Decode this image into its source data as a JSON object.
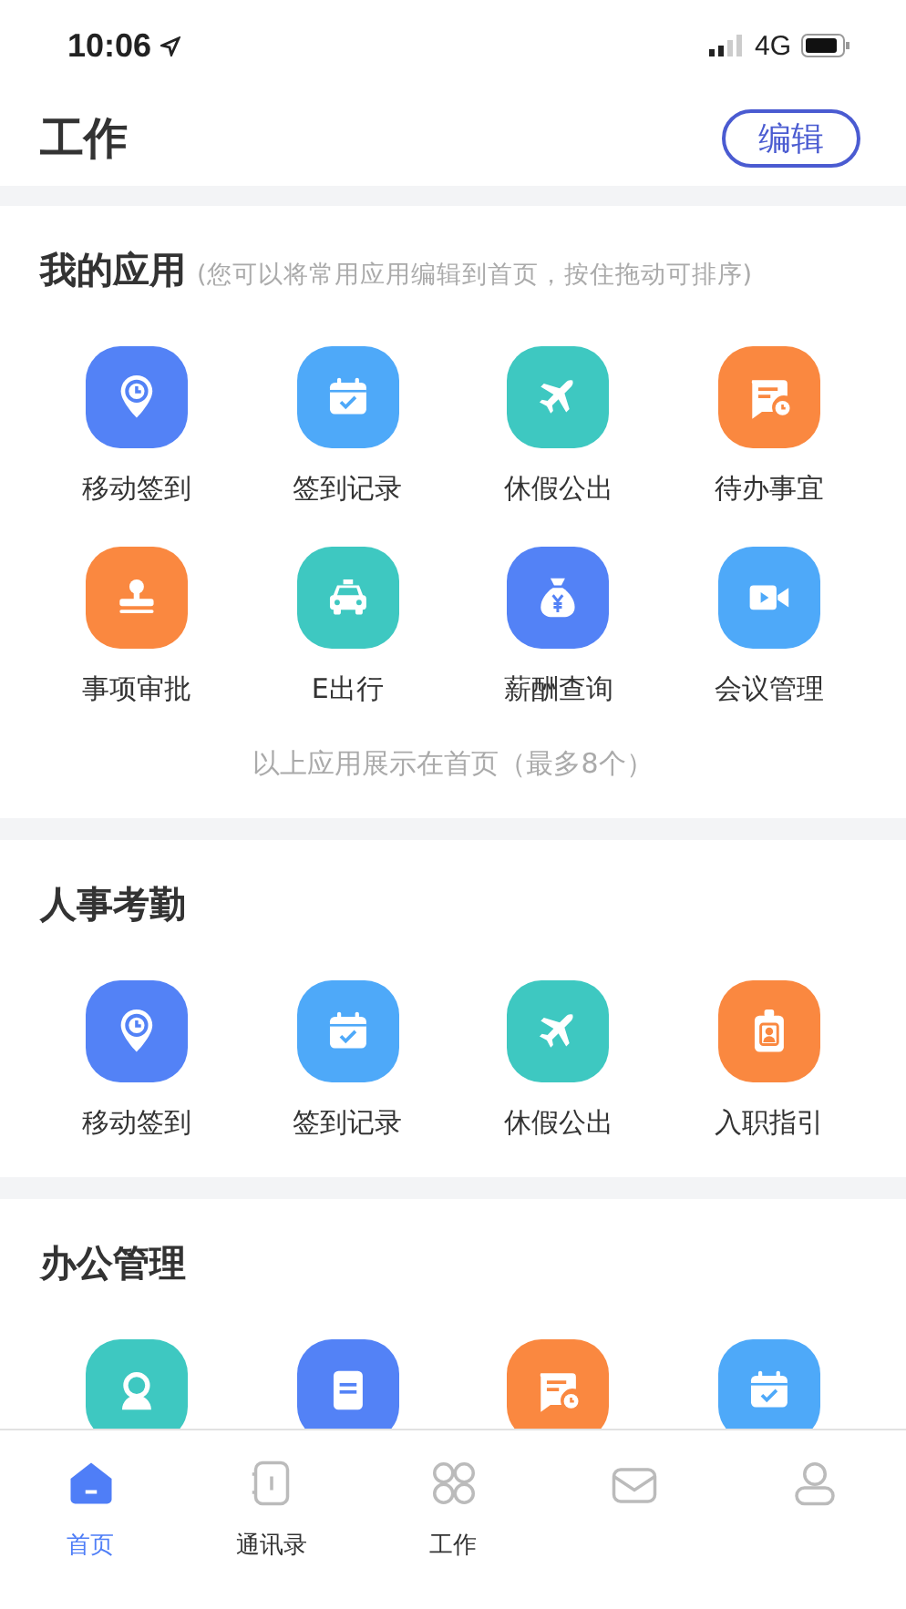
{
  "status_bar": {
    "time": "10:06",
    "network": "4G"
  },
  "header": {
    "title": "工作",
    "edit_button": "编辑"
  },
  "sections": [
    {
      "title": "我的应用",
      "hint": "(您可以将常用应用编辑到首页，按住拖动可排序)",
      "apps": [
        {
          "label": "移动签到",
          "kind": "location",
          "color": "#5382f6"
        },
        {
          "label": "签到记录",
          "kind": "calendar",
          "color": "#4ea9f9"
        },
        {
          "label": "休假公出",
          "kind": "plane",
          "color": "#3ec8c1"
        },
        {
          "label": "待办事宜",
          "kind": "message",
          "color": "#fa8840"
        },
        {
          "label": "事项审批",
          "kind": "stamp",
          "color": "#fa8840"
        },
        {
          "label": "E出行",
          "kind": "car",
          "color": "#3ec8c1"
        },
        {
          "label": "薪酬查询",
          "kind": "money",
          "color": "#5382f6"
        },
        {
          "label": "会议管理",
          "kind": "video",
          "color": "#4ea9f9"
        }
      ],
      "note": "以上应用展示在首页（最多8个）"
    },
    {
      "title": "人事考勤",
      "apps": [
        {
          "label": "移动签到",
          "kind": "location",
          "color": "#5382f6"
        },
        {
          "label": "签到记录",
          "kind": "calendar",
          "color": "#4ea9f9"
        },
        {
          "label": "休假公出",
          "kind": "plane",
          "color": "#3ec8c1"
        },
        {
          "label": "入职指引",
          "kind": "badge",
          "color": "#fa8840"
        }
      ]
    },
    {
      "title": "办公管理",
      "apps": [
        {
          "kind": "user",
          "color": "#3ec8c1"
        },
        {
          "kind": "document",
          "color": "#5382f6"
        },
        {
          "kind": "message",
          "color": "#fa8840"
        },
        {
          "kind": "calendar",
          "color": "#4ea9f9"
        }
      ]
    }
  ],
  "tabs": [
    {
      "label": "首页",
      "kind": "home",
      "selected": true
    },
    {
      "label": "通讯录",
      "kind": "contacts",
      "selected": false
    },
    {
      "label": "工作",
      "kind": "grid",
      "selected": false
    },
    {
      "kind": "mail",
      "selected": false
    },
    {
      "kind": "person",
      "selected": false
    }
  ]
}
